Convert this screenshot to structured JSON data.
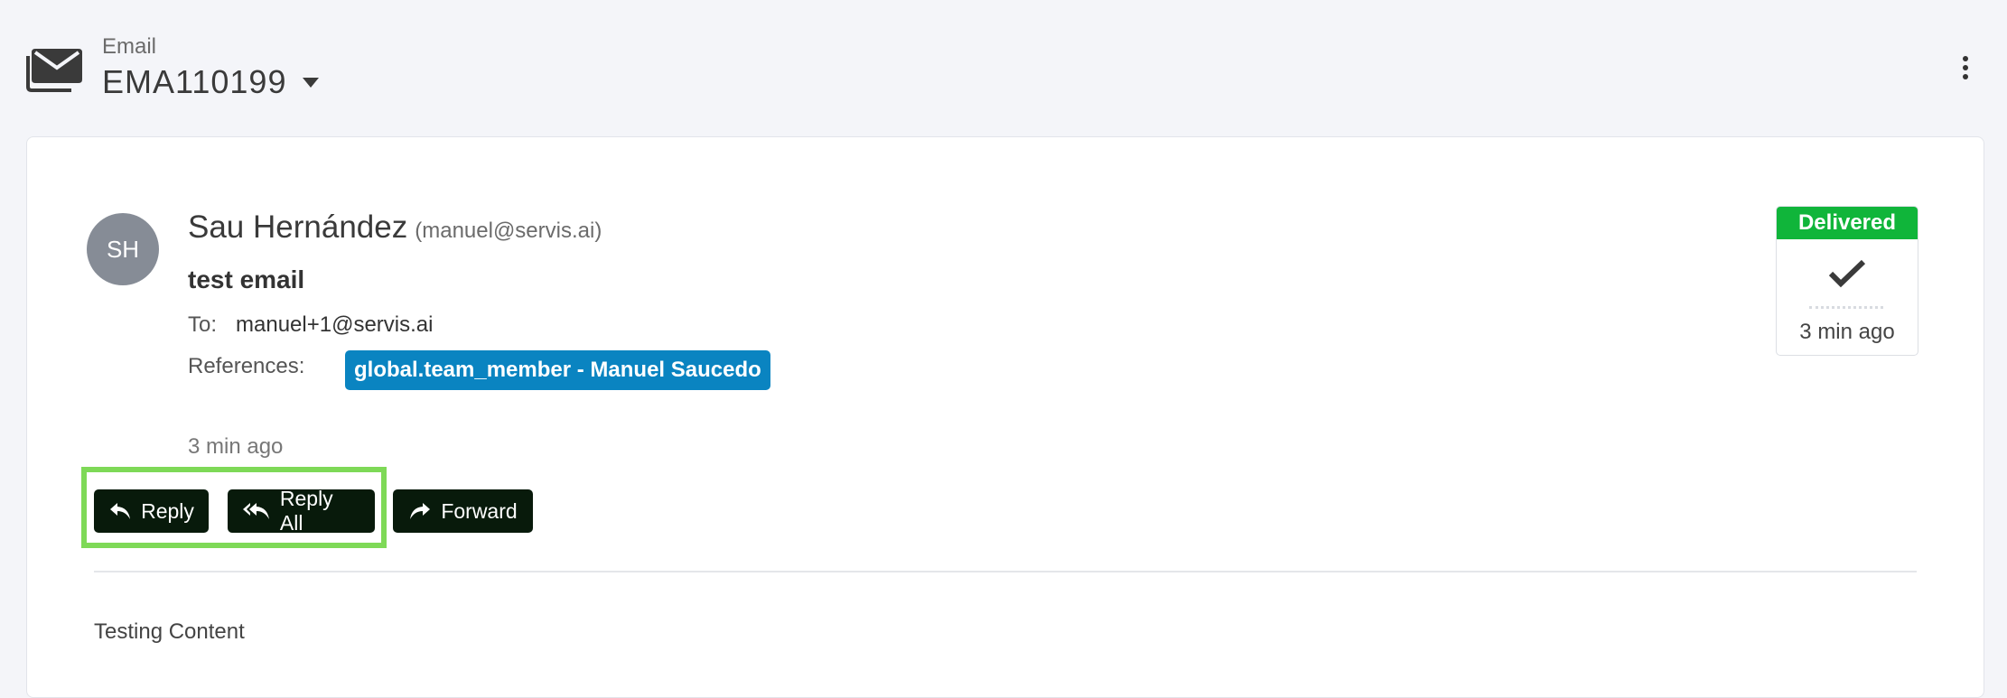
{
  "header": {
    "type_label": "Email",
    "record_id": "EMA110199"
  },
  "message": {
    "avatar_initials": "SH",
    "sender_name": "Sau Hernández",
    "sender_email": "(manuel@servis.ai)",
    "subject": "test email",
    "to_label": "To:",
    "to_value": "manuel+1@servis.ai",
    "references_label": "References:",
    "reference_badge": "global.team_member - Manuel Saucedo",
    "time_ago": "3 min ago",
    "body": "Testing Content"
  },
  "actions": {
    "reply": "Reply",
    "reply_all": "Reply All",
    "forward": "Forward"
  },
  "status": {
    "label": "Delivered",
    "time_ago": "3 min ago"
  },
  "colors": {
    "delivered": "#10b53a",
    "reference_badge": "#0a84c1",
    "button_bg": "#081a0b",
    "highlight": "#7ed957"
  }
}
